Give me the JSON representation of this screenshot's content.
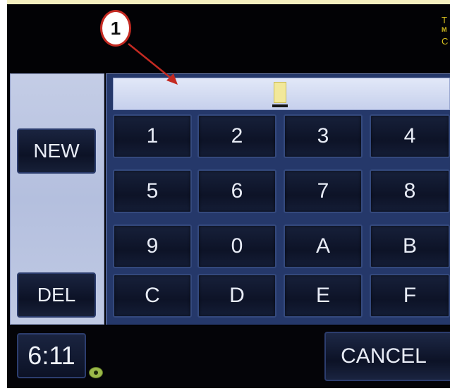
{
  "callout": {
    "number": "1"
  },
  "corner_label": {
    "line1": "T",
    "line2": "M",
    "line3": "C"
  },
  "keypad": {
    "keys": [
      "1",
      "2",
      "3",
      "4",
      "5",
      "6",
      "7",
      "8",
      "9",
      "0",
      "A",
      "B",
      "C",
      "D",
      "E",
      "F"
    ]
  },
  "side_buttons": {
    "new_label": "NEW",
    "del_label": "DEL"
  },
  "bottom": {
    "clock": "6:11",
    "cancel_label": "CANCEL"
  },
  "colors": {
    "callout_border": "#c42a22",
    "arrow": "#c42a22",
    "corner_text": "#d8c11f",
    "panel_blue": "#25386a",
    "side_panel": "#b8c2df",
    "cursor": "#f2e89a",
    "status_dot": "#9bb94a"
  }
}
